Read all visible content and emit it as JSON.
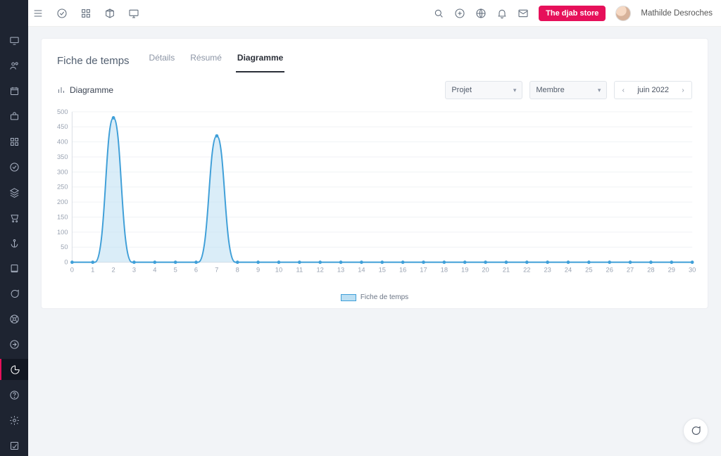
{
  "header": {
    "store_button": "The djab store",
    "user_name": "Mathilde Desroches"
  },
  "page": {
    "title": "Fiche de temps",
    "tabs": [
      {
        "label": "Détails",
        "active": false
      },
      {
        "label": "Résumé",
        "active": false
      },
      {
        "label": "Diagramme",
        "active": true
      }
    ],
    "section_label": "Diagramme"
  },
  "filters": {
    "project_label": "Projet",
    "member_label": "Membre",
    "month_label": "juin 2022"
  },
  "legend": {
    "series1": "Fiche de temps"
  },
  "chart_data": {
    "type": "area",
    "title": "",
    "xlabel": "",
    "ylabel": "",
    "ylim": [
      0,
      500
    ],
    "yticks": [
      0,
      50,
      100,
      150,
      200,
      250,
      300,
      350,
      400,
      450,
      500
    ],
    "x": [
      0,
      1,
      2,
      3,
      4,
      5,
      6,
      7,
      8,
      9,
      10,
      11,
      12,
      13,
      14,
      15,
      16,
      17,
      18,
      19,
      20,
      21,
      22,
      23,
      24,
      25,
      26,
      27,
      28,
      29,
      30
    ],
    "series": [
      {
        "name": "Fiche de temps",
        "values": [
          0,
          0,
          480,
          0,
          0,
          0,
          0,
          420,
          0,
          0,
          0,
          0,
          0,
          0,
          0,
          0,
          0,
          0,
          0,
          0,
          0,
          0,
          0,
          0,
          0,
          0,
          0,
          0,
          0,
          0,
          0
        ]
      }
    ],
    "legend_position": "bottom",
    "grid": true
  }
}
